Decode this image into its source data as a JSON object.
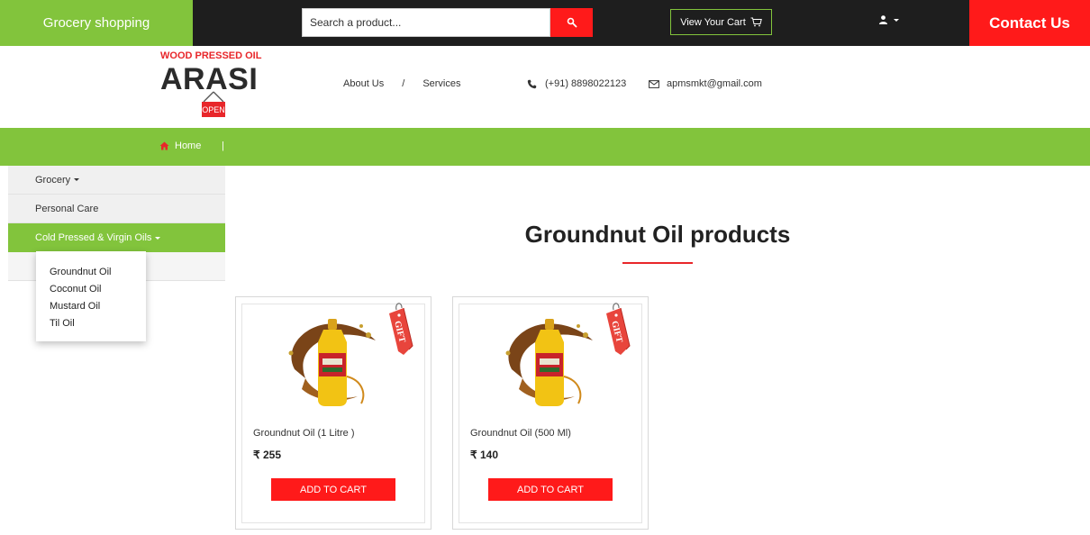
{
  "topbar": {
    "brand": "Grocery shopping",
    "search_placeholder": "Search a product...",
    "cart_label": "View Your Cart",
    "contact_label": "Contact Us"
  },
  "header": {
    "logo_tagline": "WOOD PRESSED OIL",
    "logo_name": "ARASI",
    "logo_sign": "OPEN",
    "nav": [
      {
        "label": "About Us"
      },
      {
        "label": "Services"
      }
    ],
    "nav_separator": "/",
    "phone": "(+91) 8898022123",
    "email": "apmsmkt@gmail.com"
  },
  "greenbar": {
    "home_label": "Home",
    "divider": "|"
  },
  "sidebar": {
    "items": [
      {
        "label": "Grocery"
      },
      {
        "label": "Personal Care"
      },
      {
        "label": "Cold Pressed & Virgin Oils"
      }
    ],
    "dropdown": [
      {
        "label": "Groundnut Oil"
      },
      {
        "label": "Coconut Oil"
      },
      {
        "label": "Mustard Oil"
      },
      {
        "label": "Til Oil"
      }
    ]
  },
  "main": {
    "title": "Groundnut Oil products",
    "products": [
      {
        "name": "Groundnut Oil (1 Litre )",
        "price": "₹ 255",
        "button": "ADD TO CART",
        "badge": "GIFT"
      },
      {
        "name": "Groundnut Oil (500 Ml)",
        "price": "₹ 140",
        "button": "ADD TO CART",
        "badge": "GIFT"
      }
    ]
  },
  "colors": {
    "accent_green": "#82c43c",
    "accent_red": "#ff1a1a",
    "topbar_dark": "#1e1e1e"
  },
  "icons": {
    "search": "search-icon",
    "cart": "cart-icon",
    "user": "user-icon",
    "home": "home-icon",
    "phone": "phone-icon",
    "email": "email-icon"
  }
}
